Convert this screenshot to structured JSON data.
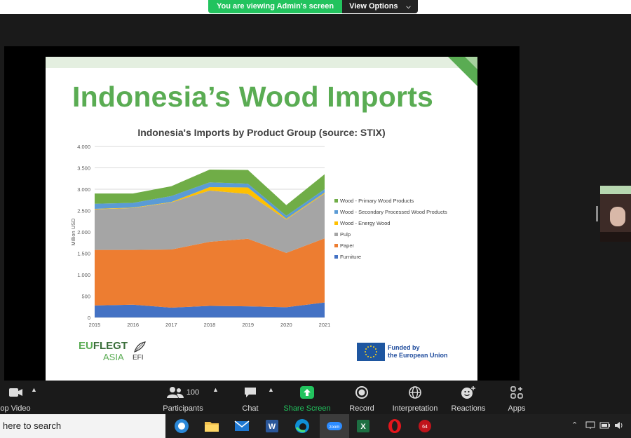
{
  "banner": {
    "message": "You are viewing Admin's screen",
    "options_label": "View Options"
  },
  "slide": {
    "title": "Indonesia’s Wood Imports",
    "logo_eu": "EU",
    "logo_flegt": "FLEGT",
    "logo_asia": "ASIA",
    "logo_efi": "EFI",
    "eu_funded_line1": "Funded by",
    "eu_funded_line2": "the European Union"
  },
  "chart_data": {
    "type": "area",
    "title": "Indonesia's Imports by Product Group (source: STIX)",
    "ylabel": "Million USD",
    "xlabel": "",
    "x": [
      "2015",
      "2016",
      "2017",
      "2018",
      "2019",
      "2020",
      "2021"
    ],
    "ylim": [
      0,
      4000
    ],
    "yticks": [
      "0",
      "500",
      "1.000",
      "1.500",
      "2.000",
      "2.500",
      "3.000",
      "3.500",
      "4.000"
    ],
    "stacked": true,
    "grid": true,
    "legend_position": "right",
    "series": [
      {
        "name": "Furniture",
        "color": "#4472c4",
        "values": [
          280,
          300,
          230,
          270,
          260,
          240,
          350
        ]
      },
      {
        "name": "Paper",
        "color": "#ed7d31",
        "values": [
          1300,
          1280,
          1360,
          1500,
          1580,
          1270,
          1500
        ]
      },
      {
        "name": "Pulp",
        "color": "#a5a5a5",
        "values": [
          950,
          980,
          1100,
          1200,
          1050,
          780,
          1050
        ]
      },
      {
        "name": "Wood - Energy Wood",
        "color": "#ffc000",
        "values": [
          10,
          10,
          10,
          80,
          150,
          20,
          20
        ]
      },
      {
        "name": "Wood - Secondary Processed Wood Products",
        "color": "#5b9bd5",
        "values": [
          120,
          110,
          140,
          110,
          90,
          70,
          80
        ]
      },
      {
        "name": "Wood - Primary Wood Products",
        "color": "#70ad47",
        "values": [
          240,
          220,
          230,
          300,
          320,
          250,
          350
        ]
      }
    ],
    "legend_order": [
      "Wood - Primary Wood Products",
      "Wood - Secondary Processed Wood Products",
      "Wood - Energy Wood",
      "Pulp",
      "Paper",
      "Furniture"
    ]
  },
  "toolbar": {
    "video_label": "op Video",
    "participants_label": "Participants",
    "participants_count": "100",
    "chat_label": "Chat",
    "share_label": "Share Screen",
    "record_label": "Record",
    "interpretation_label": "Interpretation",
    "reactions_label": "Reactions",
    "apps_label": "Apps"
  },
  "taskbar": {
    "search_text": "here to search",
    "zoom_label": "zoom",
    "badge": "64",
    "icons": [
      "camera-icon",
      "folder-icon",
      "mail-icon",
      "word-icon",
      "edge-icon",
      "zoom-icon",
      "excel-icon",
      "opera-icon",
      "game-icon"
    ]
  }
}
